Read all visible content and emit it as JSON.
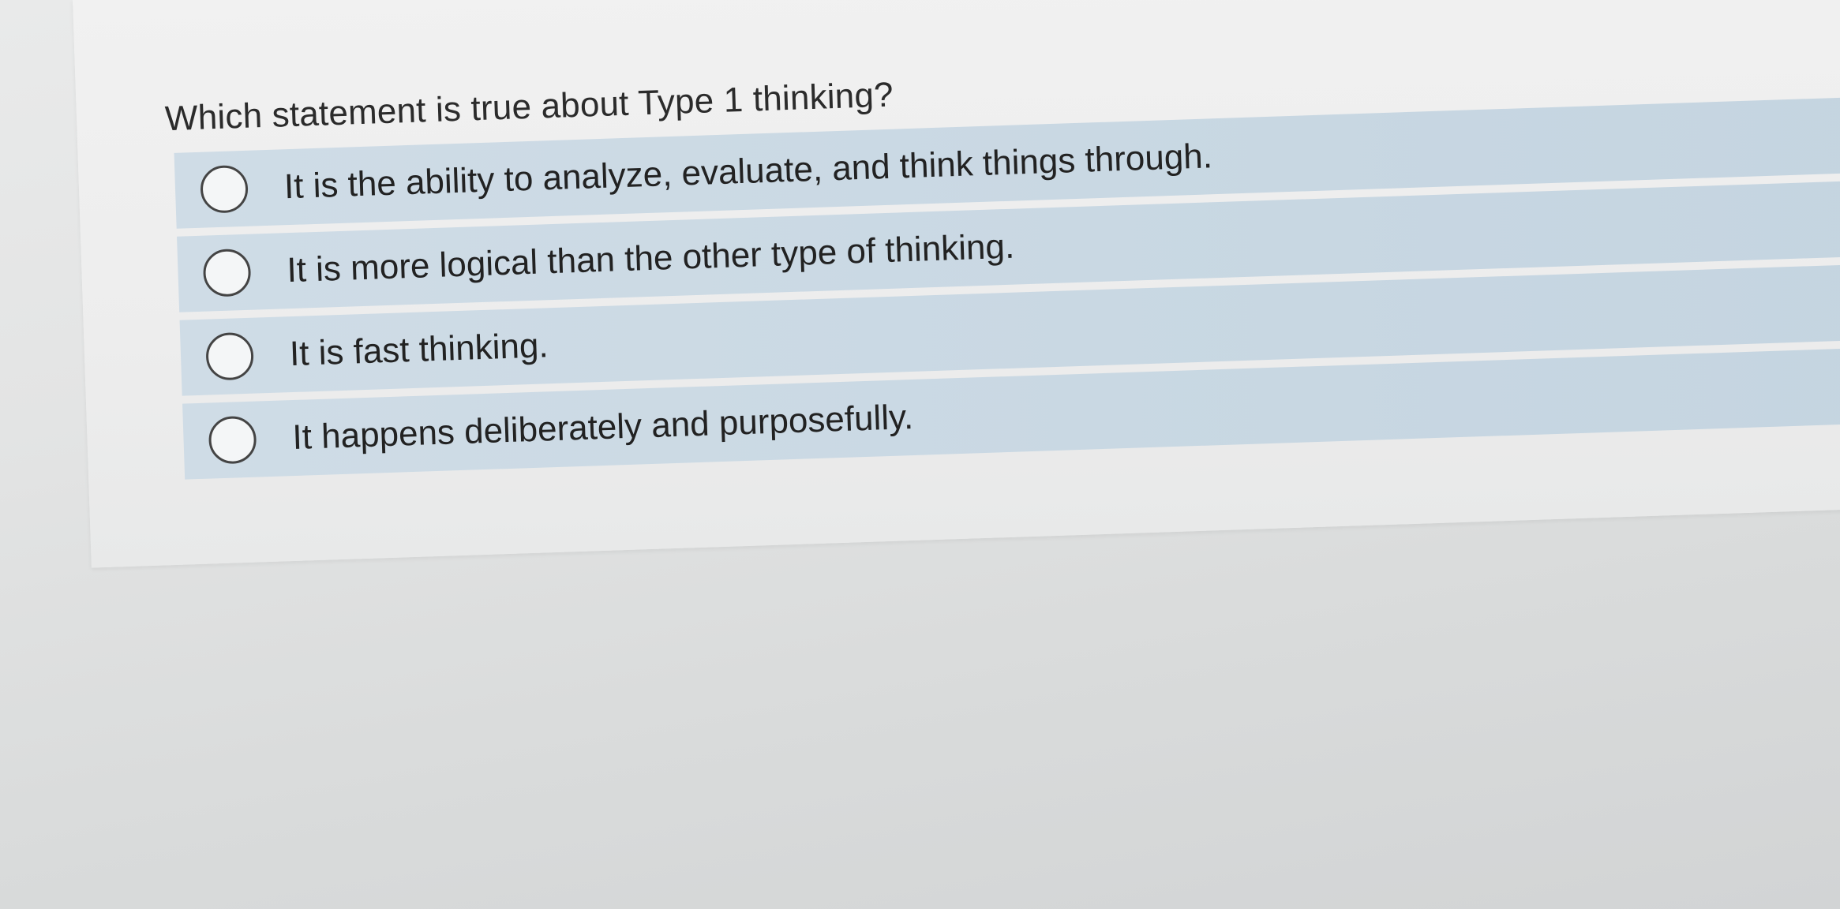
{
  "question": {
    "text": "Which statement is true about Type 1 thinking?"
  },
  "options": [
    {
      "label": "It is the ability to analyze, evaluate, and think things through.",
      "selected": false
    },
    {
      "label": "It is more logical than the other type of thinking.",
      "selected": false
    },
    {
      "label": "It is fast thinking.",
      "selected": false
    },
    {
      "label": "It happens deliberately and purposefully.",
      "selected": false
    }
  ],
  "colors": {
    "option_background": "#c9d8e3",
    "card_background": "#efefef",
    "text": "#222222"
  }
}
